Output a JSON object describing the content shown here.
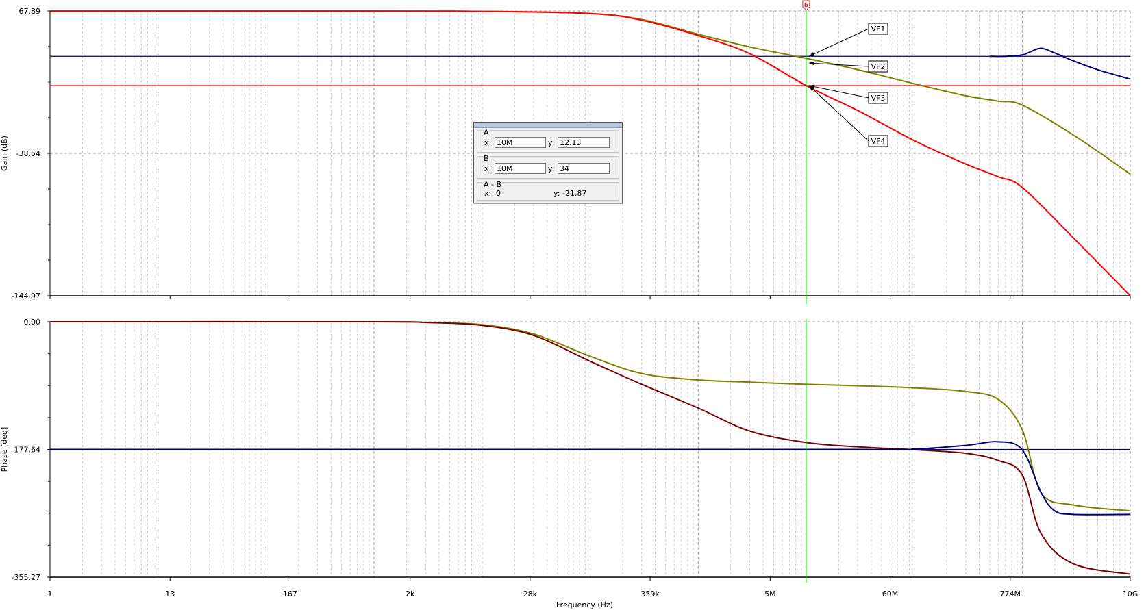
{
  "chart_data": [
    {
      "type": "line",
      "title": "",
      "xlabel": "",
      "ylabel": "Gain (dB)",
      "x_scale": "log",
      "xlim": [
        1,
        10000000000
      ],
      "ylim": [
        -144.97,
        67.89
      ],
      "y_tick_labels": [
        "67.89",
        "-38.54",
        "-144.97"
      ],
      "x_tick_labels": [
        "1",
        "13",
        "167",
        "2k",
        "28k",
        "359k",
        "5M",
        "60M",
        "774M",
        "10G"
      ],
      "grid": true,
      "series": [
        {
          "color": "#808000",
          "x": [
            1,
            1000,
            10000,
            100000,
            300000,
            1000000,
            3000000,
            10000000,
            30000000,
            100000000,
            300000000,
            600000000,
            1000000000,
            3000000000,
            10000000000
          ],
          "y": [
            67.8,
            67.8,
            67.6,
            66.0,
            61.5,
            50.5,
            41.0,
            32.5,
            24.0,
            13.5,
            4.5,
            0.5,
            -2.5,
            -25.0,
            -54.0
          ]
        },
        {
          "color": "#ff0000",
          "x": [
            1,
            1000,
            10000,
            100000,
            300000,
            1000000,
            3000000,
            10000000,
            30000000,
            100000000,
            300000000,
            600000000,
            1000000000,
            3000000000,
            10000000000
          ],
          "y": [
            67.8,
            67.8,
            67.6,
            66.0,
            61.0,
            49.5,
            36.0,
            12.1,
            -6.5,
            -29.0,
            -46.5,
            -56.0,
            -64.0,
            -102.0,
            -144.97
          ]
        },
        {
          "color": "#000080",
          "x": [
            500000000,
            700000000,
            1000000000,
            1200000000,
            1500000000,
            2000000000,
            3000000000,
            5000000000,
            10000000000
          ],
          "y": [
            34.0,
            34.0,
            35.0,
            37.5,
            40.0,
            36.5,
            30.5,
            24.0,
            17.0
          ]
        }
      ],
      "hlines": [
        {
          "color": "#000080",
          "y": 34
        },
        {
          "color": "#ff0000",
          "y": 12.13
        }
      ],
      "cursor": {
        "x": 10000000,
        "label": "b",
        "color": "#00cc00"
      },
      "annotations": [
        {
          "text": "VF1",
          "x": 10000000,
          "y": 34
        },
        {
          "text": "VF2",
          "x": 10000000,
          "y": 29
        },
        {
          "text": "VF3",
          "x": 10000000,
          "y": 12.13
        },
        {
          "text": "VF4",
          "x": 10000000,
          "y": 12.13
        }
      ]
    },
    {
      "type": "line",
      "title": "",
      "xlabel": "Frequency (Hz)",
      "ylabel": "Phase [deg]",
      "x_scale": "log",
      "xlim": [
        1,
        10000000000
      ],
      "ylim": [
        -355.27,
        0.0
      ],
      "y_tick_labels": [
        "0.00",
        "-177.64",
        "-355.27"
      ],
      "x_tick_labels": [
        "1",
        "13",
        "167",
        "2k",
        "28k",
        "359k",
        "5M",
        "60M",
        "774M",
        "10G"
      ],
      "grid": true,
      "series": [
        {
          "color": "#808000",
          "x": [
            1,
            1000,
            3000,
            10000,
            30000,
            100000,
            300000,
            1000000,
            3000000,
            10000000,
            30000000,
            100000000,
            300000000,
            600000000,
            1000000000,
            1500000000,
            3000000000,
            10000000000
          ],
          "y": [
            0,
            0,
            -1,
            -4,
            -17,
            -48,
            -72,
            -81,
            -84,
            -87,
            -89,
            -92,
            -97,
            -108,
            -150,
            -238,
            -255,
            -263
          ]
        },
        {
          "color": "#7a0000",
          "x": [
            1,
            1000,
            3000,
            10000,
            30000,
            100000,
            300000,
            1000000,
            3000000,
            10000000,
            30000000,
            100000000,
            300000000,
            600000000,
            1000000000,
            1500000000,
            3000000000,
            10000000000
          ],
          "y": [
            0,
            0,
            -1,
            -5,
            -19,
            -55,
            -87,
            -120,
            -152,
            -168,
            -174,
            -178,
            -183,
            -193,
            -213,
            -295,
            -337,
            -351
          ]
        },
        {
          "color": "#000080",
          "x": [
            1,
            30000000,
            100000000,
            300000000,
            600000000,
            1000000000,
            1500000000,
            2000000000,
            3000000000,
            10000000000
          ],
          "y": [
            -177.64,
            -177.64,
            -177.0,
            -172.0,
            -167.0,
            -178.0,
            -238.0,
            -263.0,
            -268.0,
            -268.0
          ]
        }
      ],
      "hlines": [
        {
          "color": "#000080",
          "y": -177.64
        }
      ],
      "cursor": {
        "x": 10000000,
        "color": "#00cc00"
      }
    }
  ],
  "cursor_panel": {
    "a": {
      "label": "A",
      "x_label": "x:",
      "x_value": "10M",
      "y_label": "y:",
      "y_value": "12.13"
    },
    "b": {
      "label": "B",
      "x_label": "x:",
      "x_value": "10M",
      "y_label": "y:",
      "y_value": "34"
    },
    "a_minus_b": {
      "label": "A - B",
      "x_label": "x:",
      "x_value": "0",
      "y_text": "y: -21.87"
    }
  }
}
